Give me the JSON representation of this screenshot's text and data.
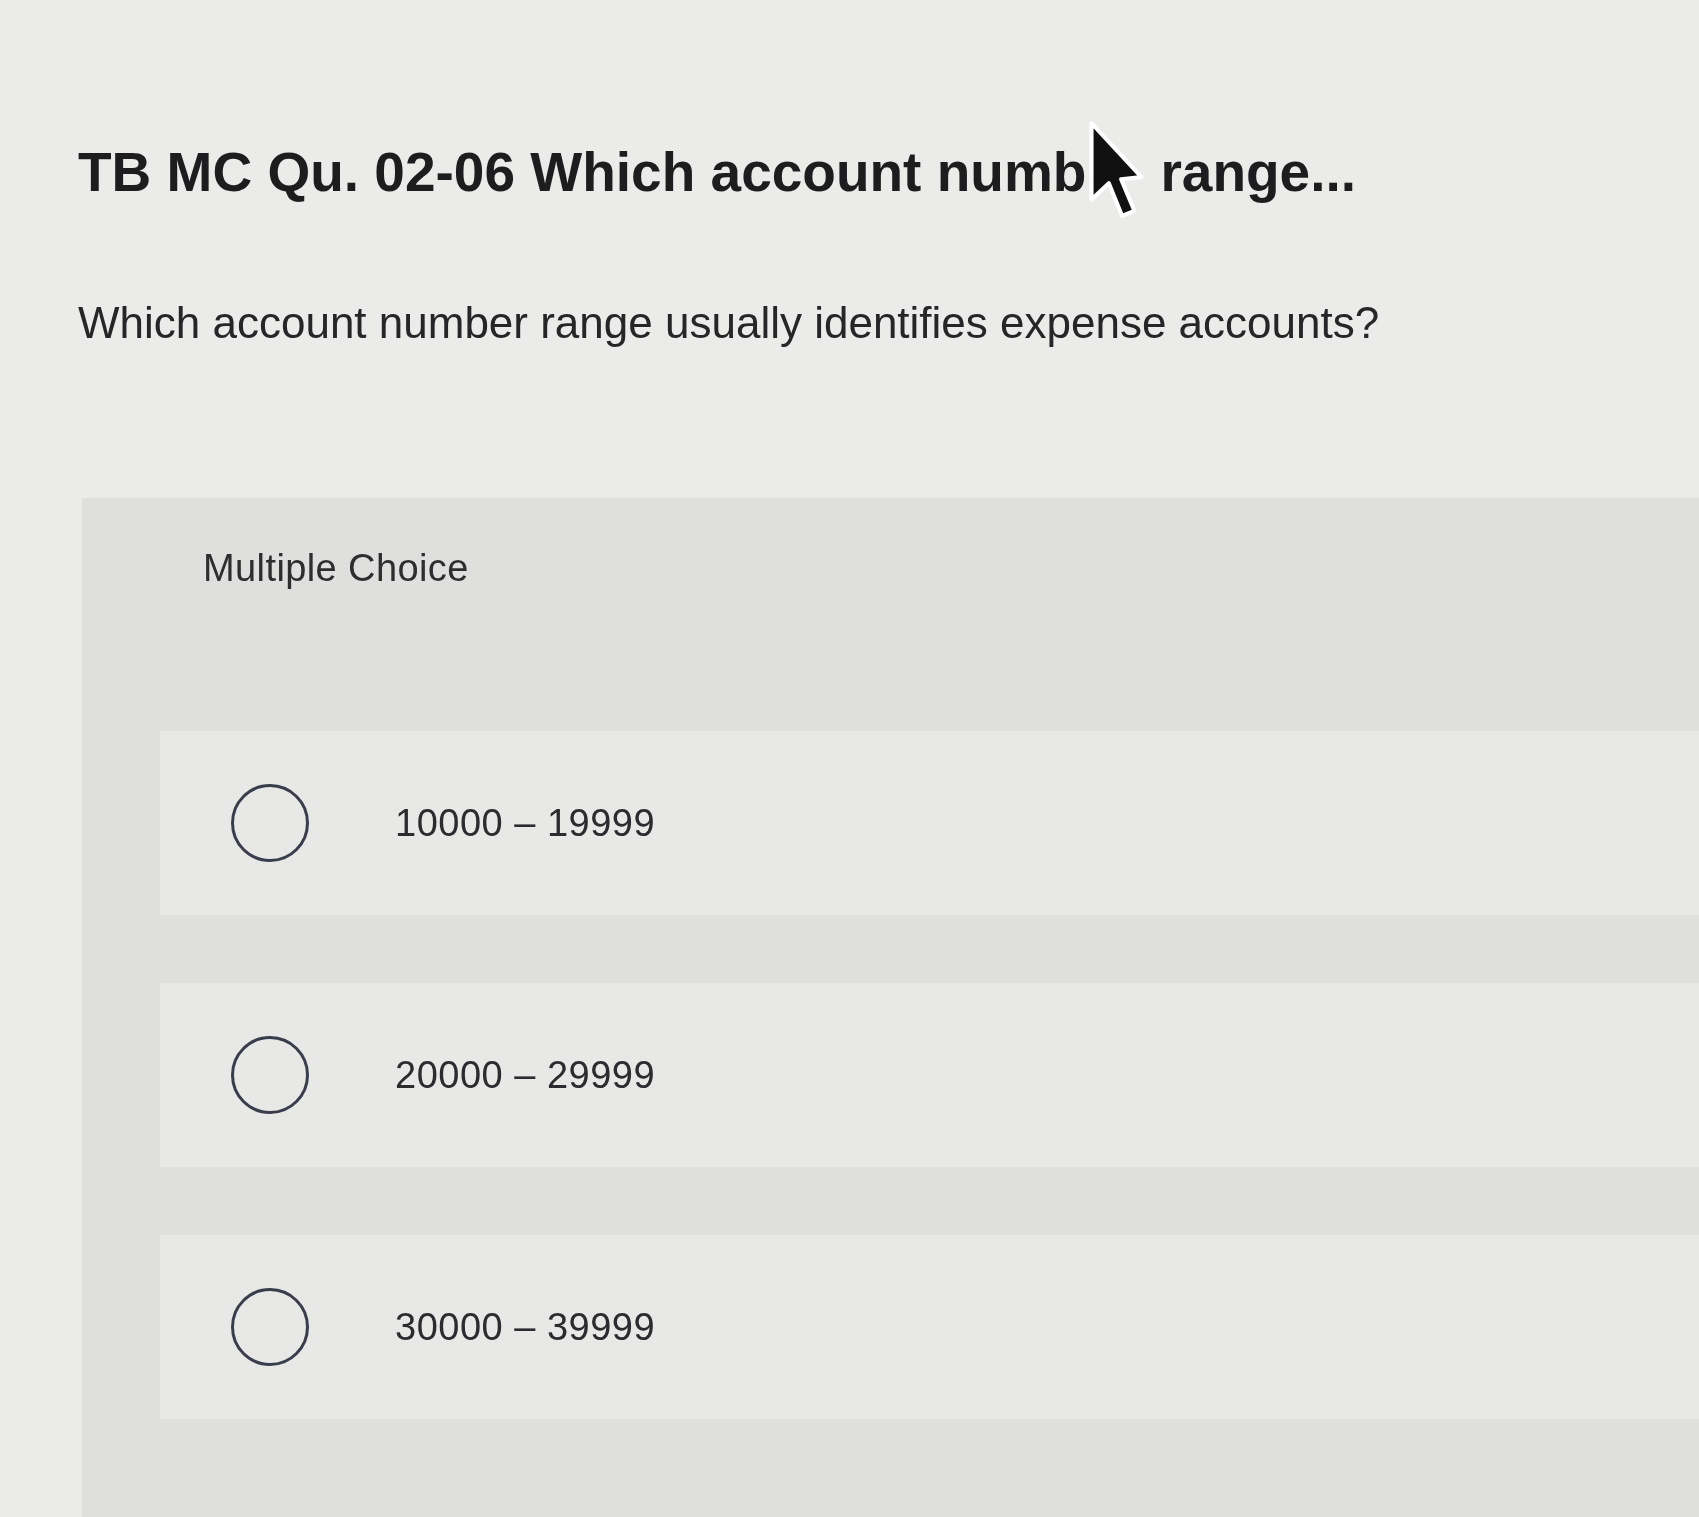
{
  "title_parts": [
    "TB MC Qu. 02-06 Which account numb",
    "range..."
  ],
  "question": "Which account number range usually identifies expense accounts?",
  "answer_panel": {
    "label": "Multiple Choice",
    "options": [
      {
        "label": "10000 – 19999",
        "selected": false
      },
      {
        "label": "20000 – 29999",
        "selected": false
      },
      {
        "label": "30000 – 39999",
        "selected": false
      }
    ]
  }
}
